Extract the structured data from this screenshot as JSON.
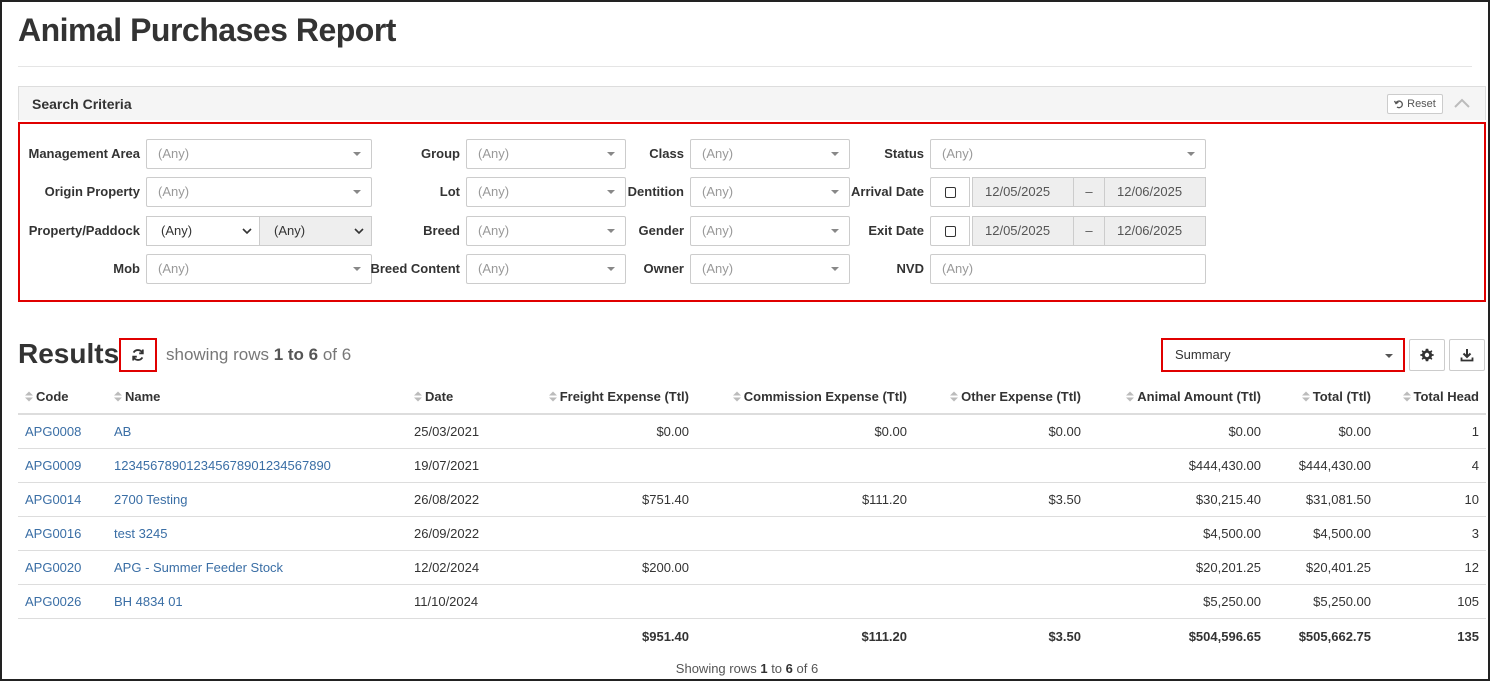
{
  "page": {
    "title": "Animal Purchases Report"
  },
  "search": {
    "title": "Search Criteria",
    "reset_label": "Reset",
    "fields": {
      "management_area": {
        "label": "Management Area",
        "value": "(Any)"
      },
      "origin_property": {
        "label": "Origin Property",
        "value": "(Any)"
      },
      "property_paddock": {
        "label": "Property/Paddock",
        "property": "(Any)",
        "paddock": "(Any)"
      },
      "mob": {
        "label": "Mob",
        "value": "(Any)"
      },
      "group": {
        "label": "Group",
        "value": "(Any)"
      },
      "lot": {
        "label": "Lot",
        "value": "(Any)"
      },
      "breed": {
        "label": "Breed",
        "value": "(Any)"
      },
      "breed_content": {
        "label": "Breed Content",
        "value": "(Any)"
      },
      "class": {
        "label": "Class",
        "value": "(Any)"
      },
      "dentition": {
        "label": "Dentition",
        "value": "(Any)"
      },
      "gender": {
        "label": "Gender",
        "value": "(Any)"
      },
      "owner": {
        "label": "Owner",
        "value": "(Any)"
      },
      "status": {
        "label": "Status",
        "value": "(Any)"
      },
      "arrival_date": {
        "label": "Arrival Date",
        "from": "12/05/2025",
        "sep": "–",
        "to": "12/06/2025"
      },
      "exit_date": {
        "label": "Exit Date",
        "from": "12/05/2025",
        "sep": "–",
        "to": "12/06/2025"
      },
      "nvd": {
        "label": "NVD",
        "placeholder": "(Any)"
      }
    }
  },
  "results": {
    "title": "Results",
    "showing_prefix": "showing rows ",
    "showing_range": "1 to 6",
    "showing_suffix": " of 6",
    "view_select": "Summary",
    "columns": [
      "Code",
      "Name",
      "Date",
      "Freight Expense (Ttl)",
      "Commission Expense (Ttl)",
      "Other Expense (Ttl)",
      "Animal Amount (Ttl)",
      "Total (Ttl)",
      "Total Head"
    ],
    "rows": [
      {
        "code": "APG0008",
        "name": "AB",
        "date": "25/03/2021",
        "freight": "$0.00",
        "commission": "$0.00",
        "other": "$0.00",
        "animal": "$0.00",
        "total": "$0.00",
        "head": "1"
      },
      {
        "code": "APG0009",
        "name": "12345678901234567890123456789​0",
        "date": "19/07/2021",
        "freight": "",
        "commission": "",
        "other": "",
        "animal": "$444,430.00",
        "total": "$444,430.00",
        "head": "4"
      },
      {
        "code": "APG0014",
        "name": "2700 Testing",
        "date": "26/08/2022",
        "freight": "$751.40",
        "commission": "$111.20",
        "other": "$3.50",
        "animal": "$30,215.40",
        "total": "$31,081.50",
        "head": "10"
      },
      {
        "code": "APG0016",
        "name": "test 3245",
        "date": "26/09/2022",
        "freight": "",
        "commission": "",
        "other": "",
        "animal": "$4,500.00",
        "total": "$4,500.00",
        "head": "3"
      },
      {
        "code": "APG0020",
        "name": "APG - Summer Feeder Stock",
        "date": "12/02/2024",
        "freight": "$200.00",
        "commission": "",
        "other": "",
        "animal": "$20,201.25",
        "total": "$20,401.25",
        "head": "12"
      },
      {
        "code": "APG0026",
        "name": "BH 4834 01",
        "date": "11/10/2024",
        "freight": "",
        "commission": "",
        "other": "",
        "animal": "$5,250.00",
        "total": "$5,250.00",
        "head": "105"
      }
    ],
    "totals": {
      "freight": "$951.40",
      "commission": "$111.20",
      "other": "$3.50",
      "animal": "$504,596.65",
      "total": "$505,662.75",
      "head": "135"
    },
    "footer_prefix": "Showing rows ",
    "footer_from": "1",
    "footer_to_word": " to ",
    "footer_to": "6",
    "footer_of_word": " of ",
    "footer_total": "6"
  }
}
